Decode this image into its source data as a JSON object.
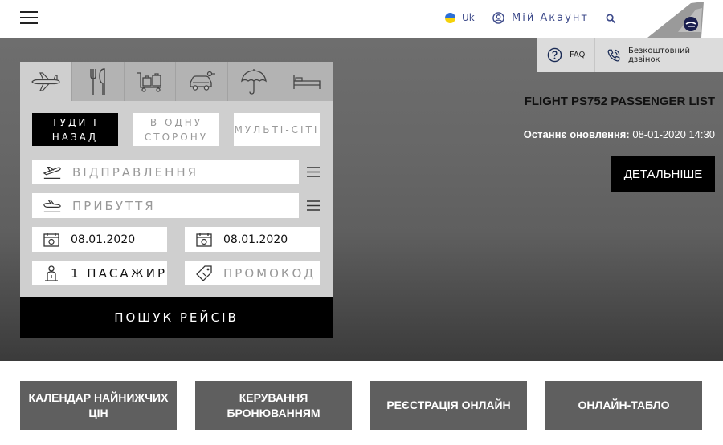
{
  "header": {
    "language": "Uk",
    "account_label": "Мій Акаунт"
  },
  "help": {
    "faq_label": "FAQ",
    "call_label": "Безкоштовний дзвінок"
  },
  "news": {
    "title": "FLIGHT PS752 PASSENGER LIST",
    "updated_label": "Останнє оновлення:",
    "updated_value": "08-01-2020 14:30",
    "more_button": "ДЕТАЛЬНІШЕ"
  },
  "booking": {
    "tabs": [
      "flights-icon",
      "food-icon",
      "baggage-icon",
      "car-icon",
      "insurance-icon",
      "hotel-icon"
    ],
    "trip_types": {
      "round": "ТУДИ І НАЗАД",
      "one_way": "В ОДНУ СТОРОНУ",
      "multi": "МУЛЬТІ-СІТІ"
    },
    "departure_placeholder": "ВІДПРАВЛЕННЯ",
    "arrival_placeholder": "ПРИБУТТЯ",
    "date_out": "08.01.2020",
    "date_back": "08.01.2020",
    "passengers": "1 ПАСАЖИР",
    "promo_placeholder": "ПРОМОКОД",
    "search_button": "ПОШУК РЕЙСІВ"
  },
  "tiles": [
    "КАЛЕНДАР НАЙНИЖЧИХ ЦІН",
    "КЕРУВАННЯ БРОНЮВАННЯМ",
    "РЕЄСТРАЦІЯ ОНЛАЙН",
    "ОНЛАЙН-ТАБЛО"
  ],
  "colors": {
    "accent_text": "#3d4a8a",
    "button_dark": "#000000",
    "tile_bg": "#5f5f5f",
    "panel_bg": "#cfcfcf"
  }
}
